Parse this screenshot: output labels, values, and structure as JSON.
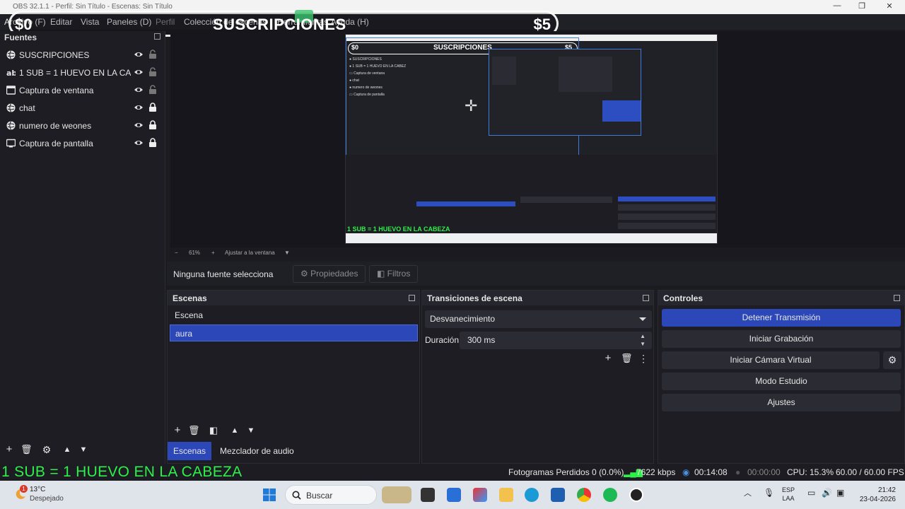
{
  "window": {
    "title": "OBS 32.1.1 - Perfil: Sin Título - Escenas: Sin Título"
  },
  "menu": {
    "items": [
      "Archivo (F)",
      "Editar",
      "Vista",
      "Paneles (D)",
      "Perfil",
      "Colección de escenas",
      "Herramientas",
      "Ayuda (H)"
    ]
  },
  "overlay": {
    "left_amount": "$0",
    "title": "SUSCRIPCIONES",
    "right_amount": "$5"
  },
  "sources": {
    "header": "Fuentes",
    "items": [
      {
        "label": "SUSCRIPCIONES",
        "icon": "browser-icon",
        "locked": false
      },
      {
        "label": "1 SUB = 1 HUEVO EN LA CABEZA",
        "icon": "text-icon",
        "locked": false
      },
      {
        "label": "Captura de ventana",
        "icon": "window-capture-icon",
        "locked": false
      },
      {
        "label": "chat",
        "icon": "browser-icon",
        "locked": true
      },
      {
        "label": "numero de weones",
        "icon": "browser-icon",
        "locked": true
      },
      {
        "label": "Captura de pantalla",
        "icon": "monitor-icon",
        "locked": true
      }
    ]
  },
  "preview": {
    "nested_title": "SUSCRIPCIONES",
    "nested_left": "$0",
    "nested_right": "$5",
    "nested_green": "1 SUB = 1 HUEVO EN LA CABEZA"
  },
  "zoom": {
    "value": "61%",
    "fit": "Ajustar a la ventana"
  },
  "selection": {
    "none_label": "Ninguna fuente selecciona",
    "properties": "Propiedades",
    "filters": "Filtros"
  },
  "scenes": {
    "header": "Escenas",
    "items": [
      "Escena",
      "aura"
    ],
    "active_index": 1,
    "tabs": [
      "Escenas",
      "Mezclador de audio"
    ]
  },
  "transitions": {
    "header": "Transiciones de escena",
    "selected": "Desvanecimiento",
    "duration_label": "Duración",
    "duration_value": "300 ms"
  },
  "controls": {
    "header": "Controles",
    "buttons": [
      "Detener Transmisión",
      "Iniciar Grabación",
      "Iniciar Cámara Virtual",
      "Modo Estudio",
      "Ajustes"
    ]
  },
  "status": {
    "overlay_text": "1 SUB = 1 HUEVO EN LA CABEZA",
    "dropped": "Fotogramas Perdidos 0 (0.0%)",
    "bitrate": "7622 kbps",
    "stream_time": "00:14:08",
    "rec_time": "00:00:00",
    "cpu": "CPU: 15.3%",
    "fps": "60.00 / 60.00 FPS"
  },
  "taskbar": {
    "weather_temp": "13°C",
    "weather_desc": "Despejado",
    "weather_badge": "1",
    "search": "Buscar",
    "lang_1": "ESP",
    "lang_2": "LAA",
    "time": "21:42",
    "date": "23-04-2026"
  },
  "colors": {
    "accent": "#2c47b8",
    "green_text": "#2ef04a",
    "bg": "#1c1c20"
  }
}
